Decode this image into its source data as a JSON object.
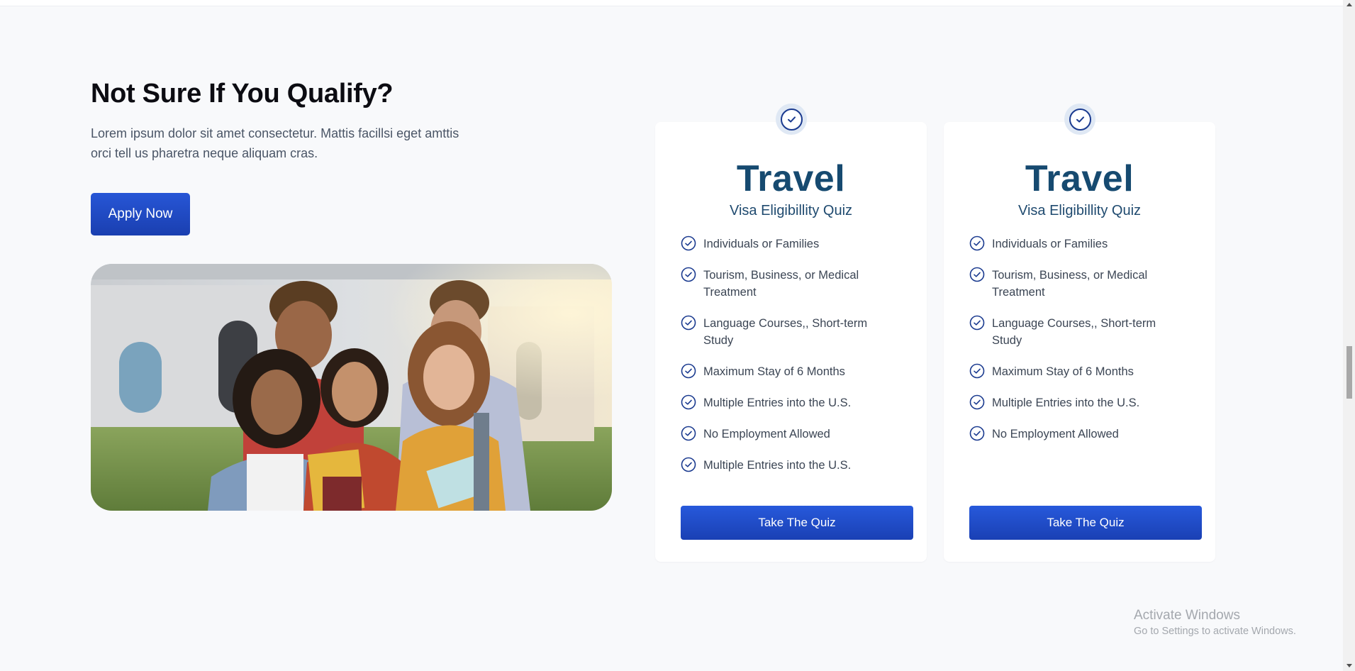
{
  "hero": {
    "heading": "Not Sure If You Qualify?",
    "description": "Lorem ipsum dolor sit amet consectetur. Mattis facillsi eget amttis orci tell us pharetra neque aliquam cras.",
    "apply_label": "Apply Now"
  },
  "cards": [
    {
      "title": "Travel",
      "subtitle": "Visa Eligibillity Quiz",
      "features": [
        "Individuals or Families",
        "Tourism, Business, or Medical Treatment",
        "Language Courses,, Short-term Study",
        "Maximum Stay of 6 Months",
        "Multiple Entries into the U.S.",
        "No Employment Allowed",
        "Multiple Entries into the U.S."
      ],
      "button_label": "Take The Quiz"
    },
    {
      "title": "Travel",
      "subtitle": "Visa Eligibillity Quiz",
      "features": [
        "Individuals or Families",
        "Tourism, Business, or Medical Treatment",
        "Language Courses,, Short-term Study",
        "Maximum Stay of 6 Months",
        "Multiple Entries into the U.S.",
        "No Employment Allowed"
      ],
      "button_label": "Take The Quiz"
    }
  ],
  "watermark": {
    "title": "Activate Windows",
    "subtitle": "Go to Settings to activate Windows."
  },
  "colors": {
    "brand_blue": "#1f4cc4",
    "title_navy": "#164a70",
    "page_bg": "#f8f9fb"
  },
  "icons": {
    "badge": "check-circle-icon",
    "feature": "check-circle-icon"
  }
}
